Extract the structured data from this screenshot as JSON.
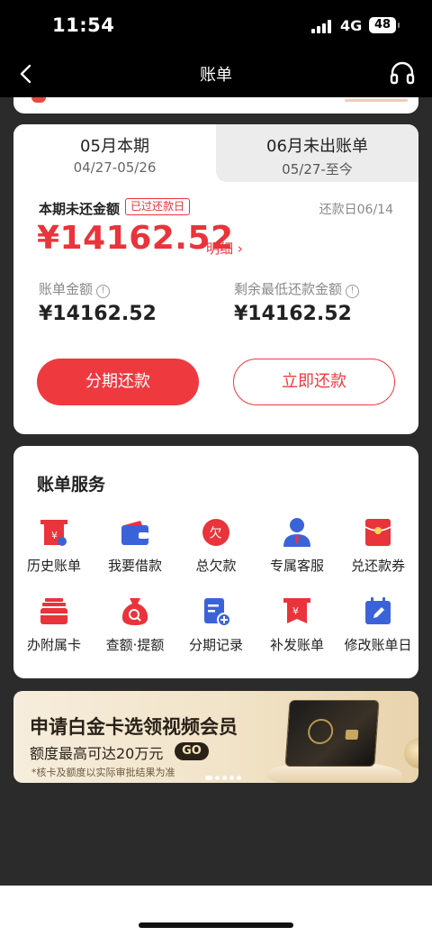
{
  "status": {
    "time": "11:54",
    "network": "4G",
    "battery": "48"
  },
  "header": {
    "title": "账单"
  },
  "tabs": [
    {
      "title": "05月本期",
      "range": "04/27-05/26"
    },
    {
      "title": "06月未出账单",
      "range": "05/27-至今"
    }
  ],
  "bill": {
    "due_label": "本期未还金额",
    "overdue_badge": "已过还款日",
    "due_date": "还款日06/14",
    "amount": "¥14162.52",
    "detail_link": "明细 ›",
    "bill_amount_label": "账单金额",
    "bill_amount": "¥14162.52",
    "min_payment_label": "剩余最低还款金额",
    "min_payment": "¥14162.52",
    "installment_button": "分期还款",
    "repay_button": "立即还款"
  },
  "services": {
    "title": "账单服务",
    "items": [
      {
        "label": "历史账单",
        "icon": "history-bill-icon"
      },
      {
        "label": "我要借款",
        "icon": "wallet-icon"
      },
      {
        "label": "总欠款",
        "icon": "debt-icon"
      },
      {
        "label": "专属客服",
        "icon": "customer-service-icon"
      },
      {
        "label": "兑还款券",
        "icon": "coupon-icon"
      },
      {
        "label": "办附属卡",
        "icon": "supplementary-card-icon"
      },
      {
        "label": "查额·提额",
        "icon": "credit-limit-icon"
      },
      {
        "label": "分期记录",
        "icon": "installment-record-icon"
      },
      {
        "label": "补发账单",
        "icon": "reissue-bill-icon"
      },
      {
        "label": "修改账单日",
        "icon": "calendar-edit-icon"
      }
    ],
    "debt_glyph": "欠",
    "yen_glyph": "¥"
  },
  "promo": {
    "title": "申请白金卡选领视频会员",
    "subtitle": "额度最高可达20万元",
    "go": "GO",
    "note": "*核卡及额度以实际审批结果为准"
  },
  "colors": {
    "accent": "#ee3a3f",
    "blue": "#3b63d9"
  }
}
